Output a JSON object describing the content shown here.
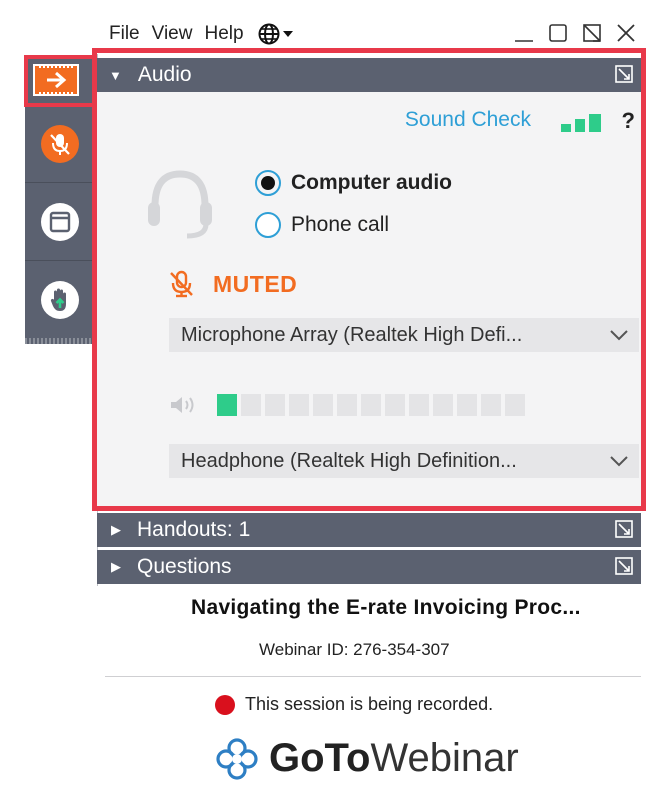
{
  "menu": {
    "file": "File",
    "view": "View",
    "help": "Help"
  },
  "audio": {
    "section_title": "Audio",
    "sound_check": "Sound Check",
    "help_icon": "?",
    "options": [
      {
        "label": "Computer audio",
        "selected": true
      },
      {
        "label": "Phone call",
        "selected": false
      }
    ],
    "muted_label": "MUTED",
    "microphone": "Microphone Array (Realtek High Defi...",
    "speaker": "Headphone (Realtek High Definition...",
    "speaker_level": 0.077,
    "speaker_level_segments": 13,
    "signal_strength": "3 of 3"
  },
  "handouts": {
    "title": "Handouts: 1"
  },
  "questions": {
    "title": "Questions"
  },
  "webinar": {
    "title": "Navigating the E-rate Invoicing Proc...",
    "id_text": "Webinar ID: 276-354-307",
    "recording_text": "This session is being recorded.",
    "logo_goto": "GoTo",
    "logo_webinar": "Webinar"
  },
  "colors": {
    "accent_orange": "#f26c21",
    "toolbar_bg": "#5b6170",
    "link_blue": "#2e9fd6",
    "highlight_red": "#e8394a",
    "level_green": "#2ecc8a",
    "record_red": "#d9101d"
  },
  "icons": {
    "toolbar": [
      "arrow-right-icon",
      "mic-muted-icon",
      "window-icon",
      "raise-hand-icon"
    ],
    "window": [
      "minimize-icon",
      "maximize-icon",
      "restore-icon",
      "close-icon"
    ]
  }
}
